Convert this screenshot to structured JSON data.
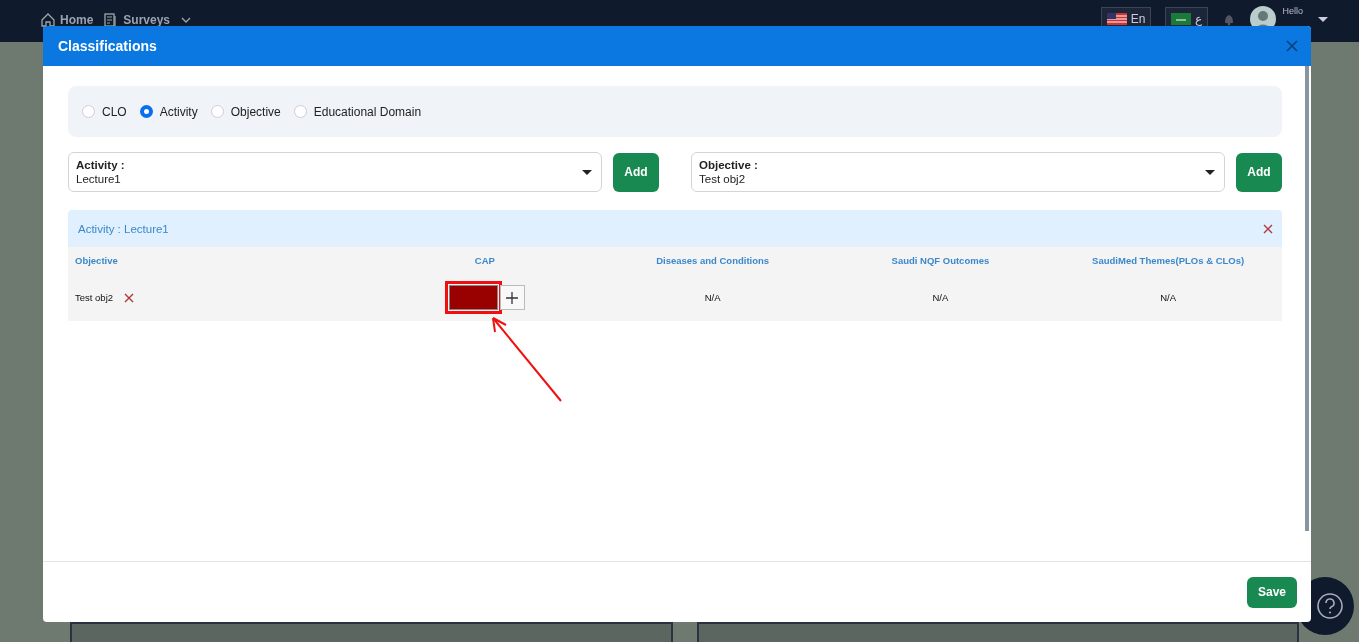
{
  "navbar": {
    "items": [
      {
        "kind": "home",
        "label": "Home"
      },
      {
        "kind": "surveys",
        "label": "Surveys"
      }
    ],
    "language_buttons": [
      {
        "label": "En",
        "kind": "us"
      },
      {
        "label": "ع",
        "kind": "sa"
      }
    ],
    "greeting": "Hello"
  },
  "modal": {
    "title": "Classifications",
    "radios": [
      {
        "label": "CLO",
        "selected": false
      },
      {
        "label": "Activity",
        "selected": true
      },
      {
        "label": "Objective",
        "selected": false
      },
      {
        "label": "Educational Domain",
        "selected": false
      }
    ],
    "selects": [
      {
        "label": "Activity :",
        "value": "Lecture1",
        "button": "Add"
      },
      {
        "label": "Objective :",
        "value": "Test obj2",
        "button": "Add"
      }
    ],
    "section": {
      "title": "Activity : Lecture1",
      "columns": [
        "Objective",
        "CAP",
        "Diseases and Conditions",
        "Saudi NQF Outcomes",
        "SaudiMed Themes(PLOs & CLOs)"
      ],
      "rows": [
        {
          "cells": [
            {
              "kind": "text",
              "text": "Test obj2",
              "removable": true
            },
            {
              "kind": "color",
              "color": "#990000"
            },
            {
              "kind": "text",
              "text": "N/A"
            },
            {
              "kind": "text",
              "text": "N/A"
            },
            {
              "kind": "text",
              "text": "N/A"
            }
          ]
        }
      ]
    },
    "save": "Save"
  }
}
